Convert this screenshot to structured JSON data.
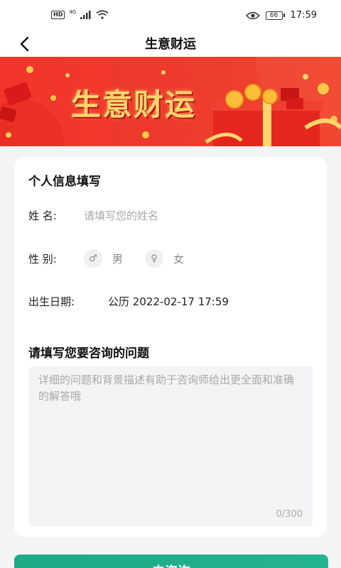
{
  "status_bar": {
    "network_type": "4G",
    "battery_level": "66",
    "time": "17:59"
  },
  "nav": {
    "title": "生意财运"
  },
  "banner": {
    "title": "生意财运"
  },
  "form": {
    "section_title": "个人信息填写",
    "name_label": "姓 名:",
    "name_placeholder": "请填写您的姓名",
    "gender_label": "性 别:",
    "gender_options": [
      {
        "symbol": "♂",
        "label": "男"
      },
      {
        "symbol": "♀",
        "label": "女"
      }
    ],
    "birth_label": "出生日期:",
    "birth_value": "公历 2022-02-17 17:59",
    "question_title": "请填写您要咨询的问题",
    "question_placeholder": "详细的问题和背景描述有助于咨询师给出更全面和准确的解答哦",
    "question_count": "0/300"
  },
  "submit_label": "去咨询",
  "colors": {
    "banner_red": "#ee3a2c",
    "banner_gold": "#ffd66b",
    "submit_green": "#22b48f"
  }
}
